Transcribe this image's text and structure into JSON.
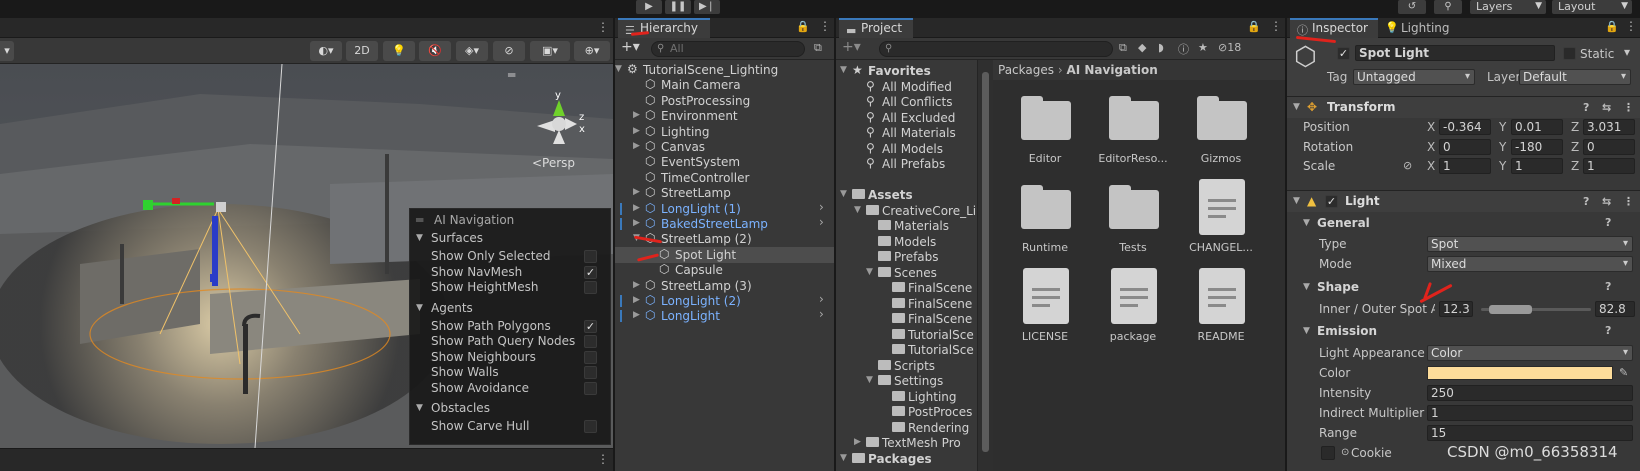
{
  "toolbar": {
    "play_icon": "play-icon",
    "pause_icon": "pause-icon",
    "step_icon": "step-icon",
    "layers_label": "Layers",
    "layout_label": "Layout"
  },
  "scene": {
    "toolbar": {
      "mode_2d": "2D"
    },
    "persp_label": "<Persp",
    "overlay": {
      "title": "AI Navigation",
      "sections": [
        {
          "label": "Surfaces",
          "items": [
            {
              "label": "Show Only Selected",
              "checked": false
            },
            {
              "label": "Show NavMesh",
              "checked": true
            },
            {
              "label": "Show HeightMesh",
              "checked": false
            }
          ]
        },
        {
          "label": "Agents",
          "items": [
            {
              "label": "Show Path Polygons",
              "checked": true
            },
            {
              "label": "Show Path Query Nodes",
              "checked": false
            },
            {
              "label": "Show Neighbours",
              "checked": false
            },
            {
              "label": "Show Walls",
              "checked": false
            },
            {
              "label": "Show Avoidance",
              "checked": false
            }
          ]
        },
        {
          "label": "Obstacles",
          "items": [
            {
              "label": "Show Carve Hull",
              "checked": false
            }
          ]
        }
      ]
    }
  },
  "hierarchy": {
    "tab_label": "Hierarchy",
    "search_placeholder": "All",
    "rows": [
      {
        "label": "TutorialScene_Lighting",
        "depth": 0,
        "expand": "open",
        "prefab": false,
        "selected": false
      },
      {
        "label": "Main Camera",
        "depth": 1,
        "expand": "none",
        "prefab": false,
        "selected": false
      },
      {
        "label": "PostProcessing",
        "depth": 1,
        "expand": "none",
        "prefab": false,
        "selected": false
      },
      {
        "label": "Environment",
        "depth": 1,
        "expand": "closed",
        "prefab": false,
        "selected": false
      },
      {
        "label": "Lighting",
        "depth": 1,
        "expand": "closed",
        "prefab": false,
        "selected": false
      },
      {
        "label": "Canvas",
        "depth": 1,
        "expand": "closed",
        "prefab": false,
        "selected": false
      },
      {
        "label": "EventSystem",
        "depth": 1,
        "expand": "none",
        "prefab": false,
        "selected": false
      },
      {
        "label": "TimeController",
        "depth": 1,
        "expand": "none",
        "prefab": false,
        "selected": false
      },
      {
        "label": "StreetLamp",
        "depth": 1,
        "expand": "closed",
        "prefab": false,
        "selected": false
      },
      {
        "label": "LongLight (1)",
        "depth": 1,
        "expand": "closed",
        "prefab": true,
        "selected": false
      },
      {
        "label": "BakedStreetLamp",
        "depth": 1,
        "expand": "closed",
        "prefab": true,
        "selected": false
      },
      {
        "label": "StreetLamp (2)",
        "depth": 1,
        "expand": "open",
        "prefab": false,
        "selected": false
      },
      {
        "label": "Spot Light",
        "depth": 2,
        "expand": "none",
        "prefab": false,
        "selected": true
      },
      {
        "label": "Capsule",
        "depth": 2,
        "expand": "none",
        "prefab": false,
        "selected": false
      },
      {
        "label": "StreetLamp (3)",
        "depth": 1,
        "expand": "closed",
        "prefab": false,
        "selected": false
      },
      {
        "label": "LongLight (2)",
        "depth": 1,
        "expand": "closed",
        "prefab": true,
        "selected": false
      },
      {
        "label": "LongLight",
        "depth": 1,
        "expand": "closed",
        "prefab": true,
        "selected": false
      }
    ]
  },
  "project": {
    "tab_label": "Project",
    "hidden_count": "18",
    "tree": [
      {
        "label": "Favorites",
        "depth": 0,
        "expand": "open",
        "kind": "star",
        "bold": true
      },
      {
        "label": "All Modified",
        "depth": 1,
        "expand": "none",
        "kind": "search",
        "bold": false
      },
      {
        "label": "All Conflicts",
        "depth": 1,
        "expand": "none",
        "kind": "search",
        "bold": false
      },
      {
        "label": "All Excluded",
        "depth": 1,
        "expand": "none",
        "kind": "search",
        "bold": false
      },
      {
        "label": "All Materials",
        "depth": 1,
        "expand": "none",
        "kind": "search",
        "bold": false
      },
      {
        "label": "All Models",
        "depth": 1,
        "expand": "none",
        "kind": "search",
        "bold": false
      },
      {
        "label": "All Prefabs",
        "depth": 1,
        "expand": "none",
        "kind": "search",
        "bold": false
      },
      {
        "label": "",
        "depth": 0,
        "expand": "none",
        "kind": "blank",
        "bold": false
      },
      {
        "label": "Assets",
        "depth": 0,
        "expand": "open",
        "kind": "folder",
        "bold": true
      },
      {
        "label": "CreativeCore_Li",
        "depth": 1,
        "expand": "open",
        "kind": "folder",
        "bold": false
      },
      {
        "label": "Materials",
        "depth": 2,
        "expand": "none",
        "kind": "folder",
        "bold": false
      },
      {
        "label": "Models",
        "depth": 2,
        "expand": "none",
        "kind": "folder",
        "bold": false
      },
      {
        "label": "Prefabs",
        "depth": 2,
        "expand": "none",
        "kind": "folder",
        "bold": false
      },
      {
        "label": "Scenes",
        "depth": 2,
        "expand": "open",
        "kind": "folder",
        "bold": false
      },
      {
        "label": "FinalScene",
        "depth": 3,
        "expand": "none",
        "kind": "folder",
        "bold": false
      },
      {
        "label": "FinalScene",
        "depth": 3,
        "expand": "none",
        "kind": "folder",
        "bold": false
      },
      {
        "label": "FinalScene",
        "depth": 3,
        "expand": "none",
        "kind": "folder",
        "bold": false
      },
      {
        "label": "TutorialSce",
        "depth": 3,
        "expand": "none",
        "kind": "folder",
        "bold": false
      },
      {
        "label": "TutorialSce",
        "depth": 3,
        "expand": "none",
        "kind": "folder",
        "bold": false
      },
      {
        "label": "Scripts",
        "depth": 2,
        "expand": "none",
        "kind": "folder",
        "bold": false
      },
      {
        "label": "Settings",
        "depth": 2,
        "expand": "open",
        "kind": "folder",
        "bold": false
      },
      {
        "label": "Lighting",
        "depth": 3,
        "expand": "none",
        "kind": "folder",
        "bold": false
      },
      {
        "label": "PostProces",
        "depth": 3,
        "expand": "none",
        "kind": "folder",
        "bold": false
      },
      {
        "label": "Rendering",
        "depth": 3,
        "expand": "none",
        "kind": "folder",
        "bold": false
      },
      {
        "label": "TextMesh Pro",
        "depth": 1,
        "expand": "closed",
        "kind": "folder",
        "bold": false
      },
      {
        "label": "Packages",
        "depth": 0,
        "expand": "open",
        "kind": "folder",
        "bold": true
      }
    ],
    "breadcrumb": [
      "Packages",
      "AI Navigation"
    ],
    "assets": [
      {
        "label": "Editor",
        "kind": "folder"
      },
      {
        "label": "EditorReso...",
        "kind": "folder"
      },
      {
        "label": "Gizmos",
        "kind": "folder"
      },
      {
        "label": "Runtime",
        "kind": "folder"
      },
      {
        "label": "Tests",
        "kind": "folder"
      },
      {
        "label": "CHANGEL...",
        "kind": "doc"
      },
      {
        "label": "LICENSE",
        "kind": "doc"
      },
      {
        "label": "package",
        "kind": "doc"
      },
      {
        "label": "README",
        "kind": "doc"
      }
    ]
  },
  "inspector": {
    "tabs": [
      "Inspector",
      "Lighting"
    ],
    "object_name": "Spot Light",
    "static_label": "Static",
    "tag_label": "Tag",
    "tag_value": "Untagged",
    "layer_label": "Layer",
    "layer_value": "Default",
    "transform": {
      "title": "Transform",
      "position_label": "Position",
      "rotation_label": "Rotation",
      "scale_label": "Scale",
      "position": {
        "x": "-0.364",
        "y": "0.01",
        "z": "3.031"
      },
      "rotation": {
        "x": "0",
        "y": "-180",
        "z": "0"
      },
      "scale": {
        "x": "1",
        "y": "1",
        "z": "1"
      },
      "axis_x": "X",
      "axis_y": "Y",
      "axis_z": "Z"
    },
    "light": {
      "title": "Light",
      "general_label": "General",
      "type_label": "Type",
      "type_value": "Spot",
      "mode_label": "Mode",
      "mode_value": "Mixed",
      "shape_label": "Shape",
      "spot_label": "Inner / Outer Spot A",
      "inner_value": "12.3",
      "outer_value": "82.8",
      "inner_fraction": 0.07,
      "outer_fraction": 0.46,
      "emission_label": "Emission",
      "appearance_label": "Light Appearance",
      "appearance_value": "Color",
      "color_label": "Color",
      "color_value": "#fddc9a",
      "intensity_label": "Intensity",
      "intensity_value": "250",
      "indirect_label": "Indirect Multiplier",
      "indirect_value": "1",
      "range_label": "Range",
      "range_value": "15",
      "cookie_label": "Cookie"
    }
  },
  "watermark": "CSDN @m0_66358314"
}
